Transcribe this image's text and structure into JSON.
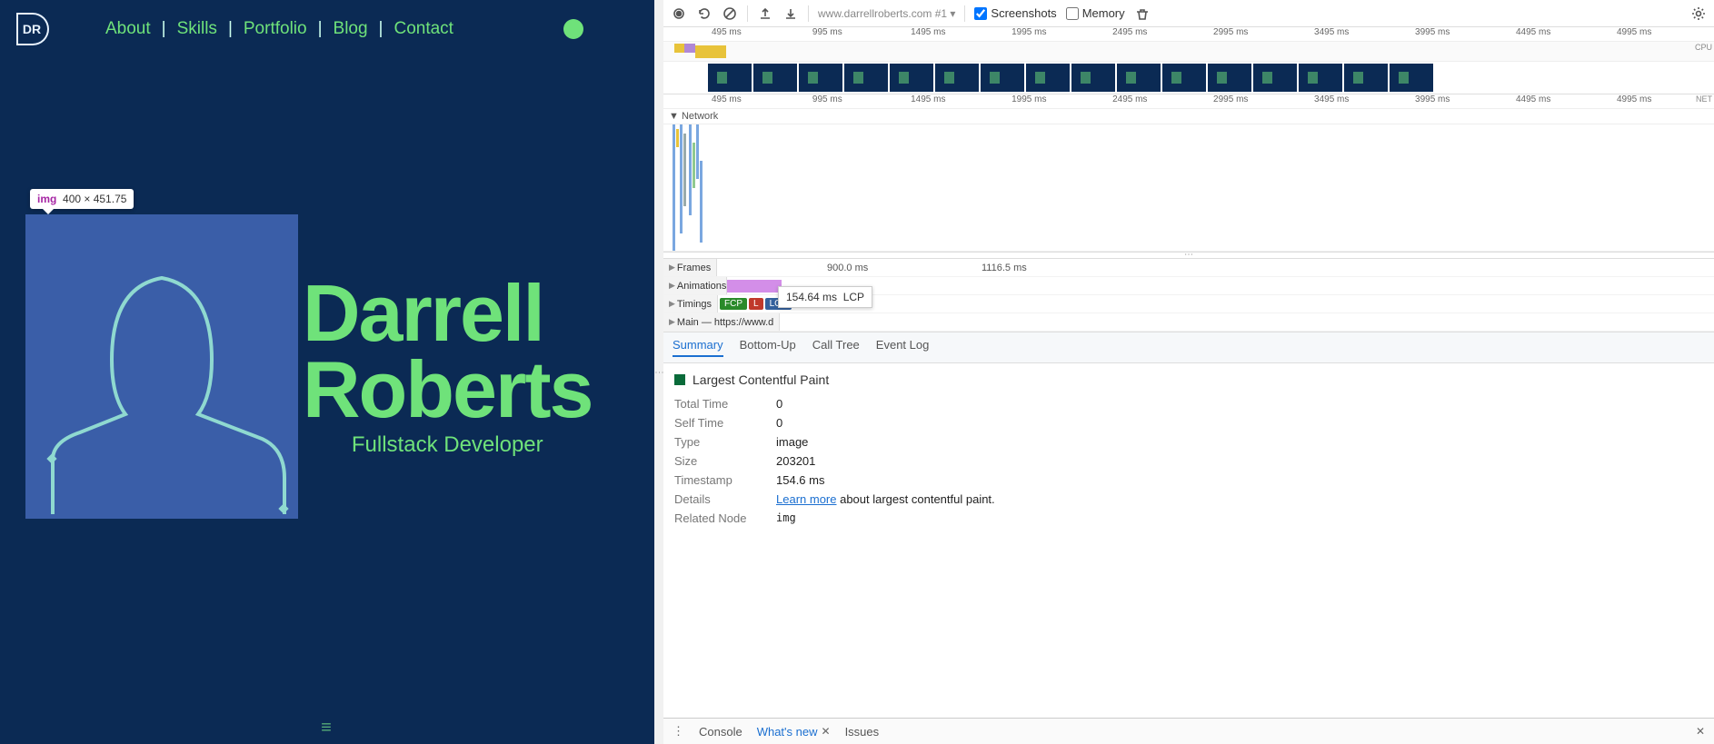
{
  "site": {
    "logo_text": "DR",
    "nav": [
      "About",
      "Skills",
      "Portfolio",
      "Blog",
      "Contact"
    ],
    "tooltip_tag": "img",
    "tooltip_dims": "400 × 451.75",
    "hero_name_1": "Darrell",
    "hero_name_2": "Roberts",
    "hero_sub": "Fullstack Developer"
  },
  "devtools": {
    "url_label": "www.darrellroberts.com #1",
    "screenshots_label": "Screenshots",
    "memory_label": "Memory",
    "ruler_ticks": [
      "495 ms",
      "995 ms",
      "1495 ms",
      "1995 ms",
      "2495 ms",
      "2995 ms",
      "3495 ms",
      "3995 ms",
      "4495 ms",
      "4995 ms"
    ],
    "cpu_label": "CPU",
    "net_label": "NET",
    "network_section": "Network",
    "frames_label": "Frames",
    "frames_times": [
      "900.0 ms",
      "1116.5 ms"
    ],
    "animations_label": "Animations",
    "timings_label": "Timings",
    "fcp": "FCP",
    "l": "L",
    "lcp": "LCP",
    "lcp_tooltip_time": "154.64 ms",
    "lcp_tooltip_name": "LCP",
    "main_label": "Main — https://www.d",
    "tabs": [
      "Summary",
      "Bottom-Up",
      "Call Tree",
      "Event Log"
    ],
    "summary": {
      "title": "Largest Contentful Paint",
      "rows": {
        "total_time_k": "Total Time",
        "total_time_v": "0",
        "self_time_k": "Self Time",
        "self_time_v": "0",
        "type_k": "Type",
        "type_v": "image",
        "size_k": "Size",
        "size_v": "203201",
        "timestamp_k": "Timestamp",
        "timestamp_v": "154.6 ms",
        "details_k": "Details",
        "learn_more": "Learn more",
        "details_rest": " about largest contentful paint.",
        "related_k": "Related Node",
        "related_tag": "img"
      }
    },
    "drawer": {
      "console": "Console",
      "whats_new": "What's new",
      "issues": "Issues"
    }
  }
}
